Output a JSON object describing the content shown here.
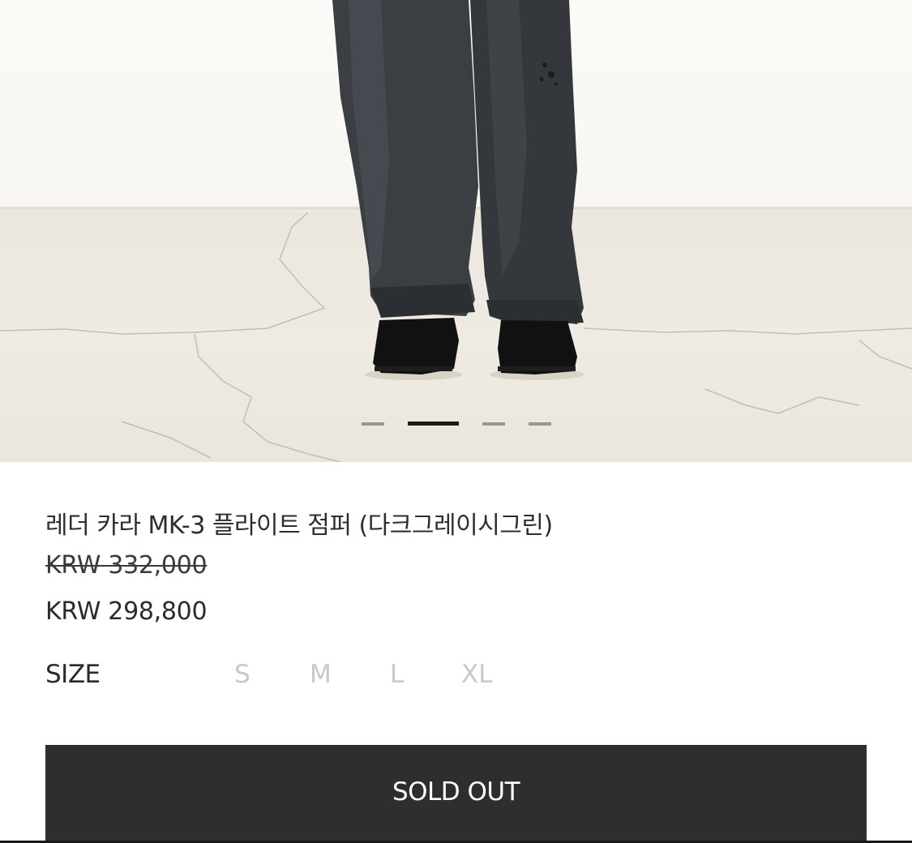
{
  "product": {
    "name": "레더 카라 MK-3 플라이트 점퍼 (다크그레이시그린)",
    "original_price": "KRW 332,000",
    "sale_price": "KRW 298,800",
    "image_alt": "Product photo: dark washed jeans and black suede shoes on a concrete floor"
  },
  "carousel": {
    "slide_count": 4,
    "active_index": 1
  },
  "size": {
    "label": "SIZE",
    "options": [
      "S",
      "M",
      "L",
      "XL"
    ]
  },
  "button": {
    "label": "SOLD OUT"
  },
  "colors": {
    "button_bg": "#2e2e2e",
    "disabled_option": "#c8c8c8",
    "text": "#2b2b2b"
  }
}
